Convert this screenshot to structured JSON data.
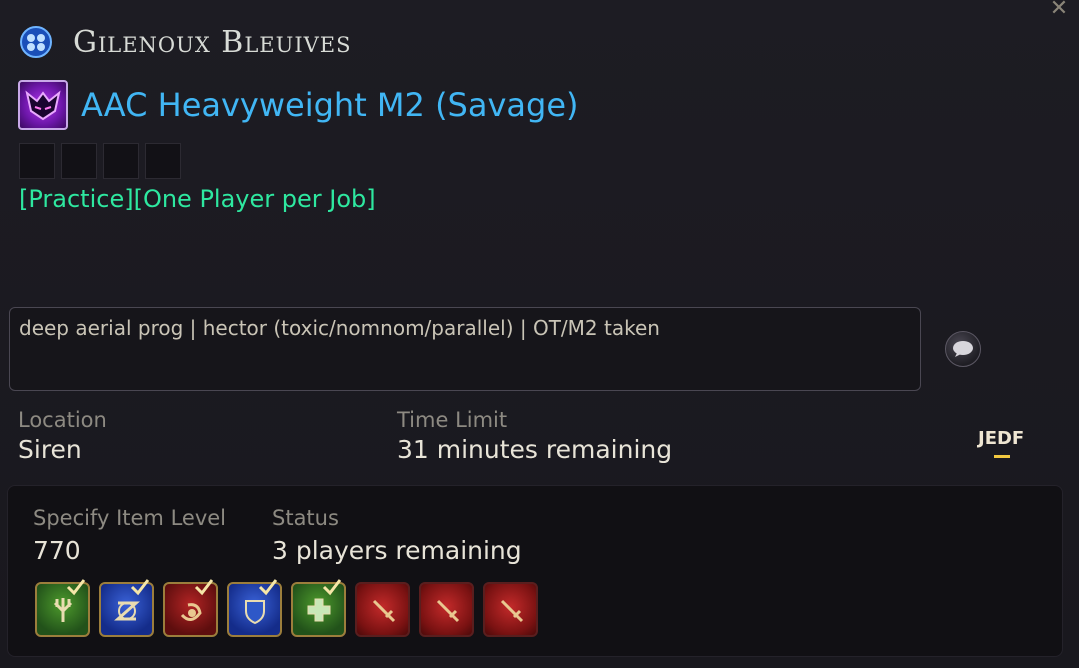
{
  "party": {
    "leader_name": "Gilenoux Bleuives",
    "duty_name": "AAC Heavyweight M2 (Savage)",
    "tags": "[Practice][One Player per Job]",
    "comment": "deep aerial prog | hector (toxic/nomnom/parallel) | OT/M2 taken",
    "location_label": "Location",
    "location_value": "Siren",
    "time_limit_label": "Time Limit",
    "time_limit_value": "31 minutes remaining",
    "language_badge": "JEDF",
    "item_level_label": "Specify Item Level",
    "item_level_value": "770",
    "status_label": "Status",
    "status_value": "3 players remaining"
  },
  "icons": {
    "close": "close-icon",
    "world": "world-cluster-icon",
    "duty": "savage-raid-icon",
    "chat": "chat-bubble-icon"
  },
  "jobs": [
    {
      "name": "dragoon-job-icon",
      "filled": true,
      "color": "#2f6e1c"
    },
    {
      "name": "astrologian-job-icon",
      "filled": true,
      "color": "#1d3fa8"
    },
    {
      "name": "ninja-job-icon",
      "filled": true,
      "color": "#8c1818"
    },
    {
      "name": "paladin-job-icon",
      "filled": true,
      "color": "#1d3fa8"
    },
    {
      "name": "healer-job-icon",
      "filled": true,
      "color": "#2f6e1c"
    },
    {
      "name": "dps-job-icon",
      "filled": false,
      "color": "#a81c1c"
    },
    {
      "name": "dps-job-icon",
      "filled": false,
      "color": "#a81c1c"
    },
    {
      "name": "dps-job-icon",
      "filled": false,
      "color": "#a81c1c"
    }
  ],
  "colors": {
    "duty_name": "#41b6f4",
    "tags": "#2ee8a0",
    "language_underline": "#f2c840"
  }
}
